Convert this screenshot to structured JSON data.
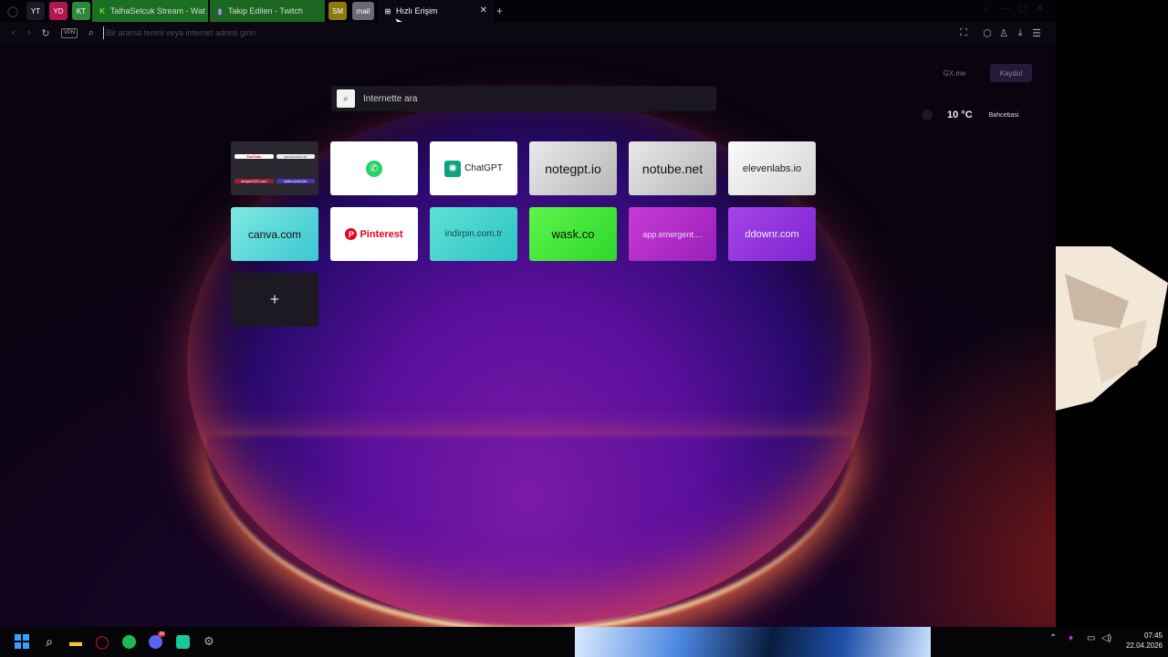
{
  "tabs": {
    "pinned": [
      {
        "label": "YT",
        "color": "#1a1a22"
      },
      {
        "label": "YD",
        "color": "#c2185b"
      },
      {
        "label": "KT",
        "color": "#2e7d32"
      }
    ],
    "items": [
      {
        "label": "TalhaSelcuk Stream - Wat",
        "color": "#1f7a1f"
      },
      {
        "label": "Takip Edilen - Twitch",
        "color": "#1e6b1e"
      }
    ],
    "pinned2": [
      {
        "label": "SM",
        "color": "#8a7a10"
      },
      {
        "label": "mail",
        "color": "#6a6a72"
      }
    ],
    "active": {
      "label": "Hızlı Erişim"
    },
    "add": "+"
  },
  "address": {
    "vpn": "VPN",
    "placeholder": "Bir arama terimi veya internet adresi girin"
  },
  "topright": {
    "gxme": "GX.me",
    "signup": "Kaydol"
  },
  "weather": {
    "temp": "10 °C",
    "location": "Bahcebasi"
  },
  "search": {
    "placeholder": "İnternette ara"
  },
  "speed_dial": {
    "folder": [
      "YouTube",
      "yabancidizi.sk",
      "dizipal1521.com",
      "hdfilmcehe.life"
    ],
    "tiles": [
      {
        "label": "",
        "icon": "whatsapp-icon"
      },
      {
        "label": "ChatGPT",
        "icon": "chatgpt-icon"
      },
      {
        "label": "notegpt.io"
      },
      {
        "label": "notube.net"
      },
      {
        "label": "elevenlabs.io"
      },
      {
        "label": "canva.com"
      },
      {
        "label": "Pinterest",
        "icon": "pinterest-icon"
      },
      {
        "label": "indirpin.com.tr"
      },
      {
        "label": "wask.co"
      },
      {
        "label": "app.emergent...."
      },
      {
        "label": "ddownr.com"
      }
    ],
    "add": "+"
  },
  "taskbar": {
    "clock_time": "07:45",
    "clock_date": "22.04.2026",
    "discord_badge": "24"
  }
}
